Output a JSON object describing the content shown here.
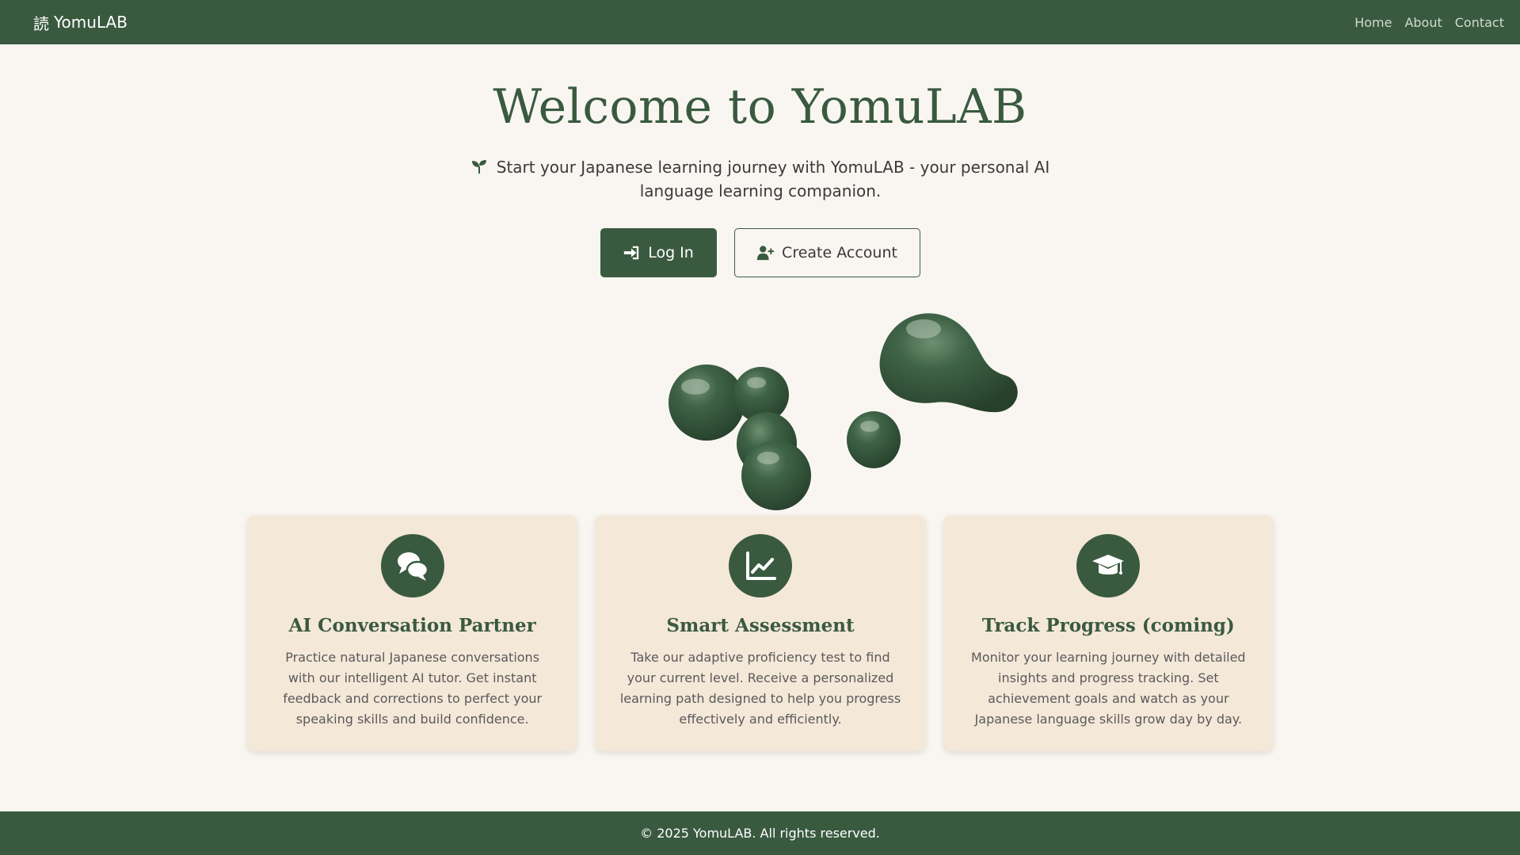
{
  "colors": {
    "brand_green": "#3a5a40",
    "background": "#f9f6f1",
    "card": "#f4e8d9"
  },
  "navbar": {
    "brand_kanji": "読",
    "brand_name": "YomuLAB",
    "links": [
      {
        "label": "Home"
      },
      {
        "label": "About"
      },
      {
        "label": "Contact"
      }
    ]
  },
  "hero": {
    "title": "Welcome to YomuLAB",
    "subtitle": "Start your Japanese learning journey with YomuLAB - your personal AI language learning companion.",
    "subtitle_icon": "seedling-icon",
    "login_label": "Log In",
    "login_icon": "sign-in-icon",
    "create_label": "Create Account",
    "create_icon": "user-plus-icon"
  },
  "features": [
    {
      "icon": "chat-bubbles-icon",
      "title": "AI Conversation Partner",
      "text": "Practice natural Japanese conversations with our intelligent AI tutor. Get instant feedback and corrections to perfect your speaking skills and build confidence."
    },
    {
      "icon": "chart-line-icon",
      "title": "Smart Assessment",
      "text": "Take our adaptive proficiency test to find your current level. Receive a personalized learning path designed to help you progress effectively and efficiently."
    },
    {
      "icon": "graduation-cap-icon",
      "title": "Track Progress (coming)",
      "text": "Monitor your learning journey with detailed insights and progress tracking. Set achievement goals and watch as your Japanese language skills grow day by day."
    }
  ],
  "footer": {
    "text": "© 2025 YomuLAB. All rights reserved."
  }
}
